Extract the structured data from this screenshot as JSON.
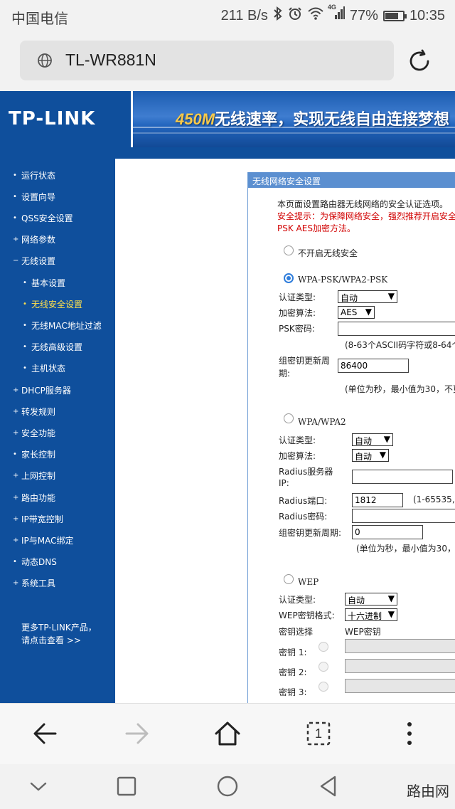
{
  "status_bar": {
    "carrier": "中国电信",
    "net_speed": "211 B/s",
    "signal_type": "4G",
    "battery": "77%",
    "battery_level": 0.77,
    "time": "10:35",
    "icons": [
      "bluetooth-icon",
      "alarm-icon",
      "wifi-icon",
      "signal-icon",
      "battery-icon"
    ]
  },
  "browser": {
    "url": "TL-WR881N",
    "tab_count": "1"
  },
  "banner": {
    "logo": "TP-LINK",
    "speed": "450M",
    "slogan": "无线速率，实现无线自由连接梦想"
  },
  "sidebar": {
    "items": [
      {
        "bullet": "•",
        "label": "运行状态"
      },
      {
        "bullet": "•",
        "label": "设置向导"
      },
      {
        "bullet": "•",
        "label": "QSS安全设置"
      },
      {
        "bullet": "+",
        "label": "网络参数"
      },
      {
        "bullet": "−",
        "label": "无线设置"
      },
      {
        "bullet": "•",
        "label": "基本设置"
      },
      {
        "bullet": "•",
        "label": "无线安全设置"
      },
      {
        "bullet": "•",
        "label": "无线MAC地址过滤"
      },
      {
        "bullet": "•",
        "label": "无线高级设置"
      },
      {
        "bullet": "•",
        "label": "主机状态"
      },
      {
        "bullet": "+",
        "label": "DHCP服务器"
      },
      {
        "bullet": "+",
        "label": "转发规则"
      },
      {
        "bullet": "+",
        "label": "安全功能"
      },
      {
        "bullet": "•",
        "label": "家长控制"
      },
      {
        "bullet": "+",
        "label": "上网控制"
      },
      {
        "bullet": "+",
        "label": "路由功能"
      },
      {
        "bullet": "+",
        "label": "IP带宽控制"
      },
      {
        "bullet": "+",
        "label": "IP与MAC绑定"
      },
      {
        "bullet": "•",
        "label": "动态DNS"
      },
      {
        "bullet": "+",
        "label": "系统工具"
      }
    ],
    "more_line1": "更多TP-LINK产品，",
    "more_line2": "请点击查看 >>"
  },
  "security": {
    "title": "无线网络安全设置",
    "intro": "本页面设置路由器无线网络的安全认证选项。",
    "tip_line1": "安全提示：为保障网络安全，强烈推荐开启安全",
    "tip_line2": "PSK AES加密方法。",
    "no_security_label": "不开启无线安全",
    "psk": {
      "label": "WPA-PSK/WPA2-PSK",
      "auth_label": "认证类型:",
      "auth_value": "自动",
      "enc_label": "加密算法:",
      "enc_value": "AES",
      "psk_label": "PSK密码:",
      "psk_value": "",
      "psk_hint": "(8-63个ASCII码字符或8-64个",
      "renew_label_1": "组密钥更新周",
      "renew_label_2": "期:",
      "renew_value": "86400",
      "renew_hint": "(单位为秒，最小值为30，不更"
    },
    "wpa": {
      "label": "WPA/WPA2",
      "auth_label": "认证类型:",
      "auth_value": "自动",
      "enc_label": "加密算法:",
      "enc_value": "自动",
      "radius_ip_label_1": "Radius服务器",
      "radius_ip_label_2": "IP:",
      "radius_ip_value": "",
      "radius_port_label": "Radius端口:",
      "radius_port_value": "1812",
      "radius_port_hint": "(1-65535,",
      "radius_pwd_label": "Radius密码:",
      "radius_pwd_value": "",
      "renew_label": "组密钥更新周期:",
      "renew_value": "0",
      "renew_hint": "(单位为秒，最小值为30，"
    },
    "wep": {
      "label": "WEP",
      "auth_label": "认证类型:",
      "auth_value": "自动",
      "format_label": "WEP密钥格式:",
      "format_value": "十六进制",
      "key_select_label": "密钥选择",
      "key_col_label": "WEP密钥",
      "keys": [
        "密钥 1:",
        "密钥 2:",
        "密钥 3:"
      ]
    }
  },
  "watermark": "路由网",
  "colors": {
    "tplink_blue": "#0f4f9c",
    "panel_header": "#5b8fd0",
    "warning_red": "#d10000",
    "active_menu": "#ffe14c"
  }
}
